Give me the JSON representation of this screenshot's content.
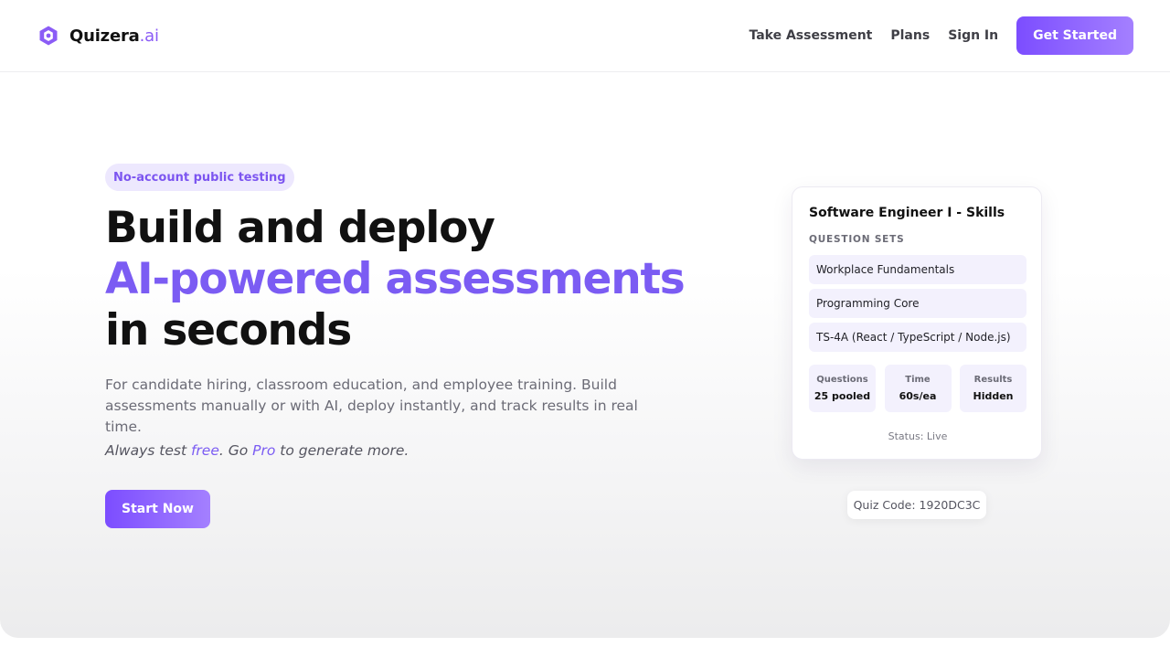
{
  "brand": {
    "name": "Quizera",
    "tld": ".ai",
    "icon": "hexagon-logo-icon",
    "accent_color": "#7b5cf3"
  },
  "nav": {
    "links": [
      "Take Assessment",
      "Plans",
      "Sign In"
    ],
    "cta_label": "Get Started"
  },
  "hero": {
    "badge": "No-account public testing",
    "headline_line1": "Build and deploy",
    "headline_line2": "AI-powered assessments",
    "headline_line3": "in seconds",
    "description": "For candidate hiring, classroom education, and employee training. Build assessments manually or with AI, deploy instantly, and track results in real time.",
    "tagline": {
      "part1": "Always test ",
      "free": "free",
      "part2": ". Go ",
      "pro": "Pro",
      "part3": " to generate more."
    },
    "start_label": "Start Now"
  },
  "card": {
    "title": "Software Engineer I - Skills",
    "section_label": "QUESTION SETS",
    "question_sets": [
      "Workplace Fundamentals",
      "Programming Core",
      "TS-4A (React / TypeScript / Node.js)"
    ],
    "stats": [
      {
        "label": "Questions",
        "value": "25 pooled"
      },
      {
        "label": "Time",
        "value": "60s/ea"
      },
      {
        "label": "Results",
        "value": "Hidden"
      }
    ],
    "status": "Status: Live"
  },
  "quiz_code": "Quiz Code: 1920DC3C"
}
